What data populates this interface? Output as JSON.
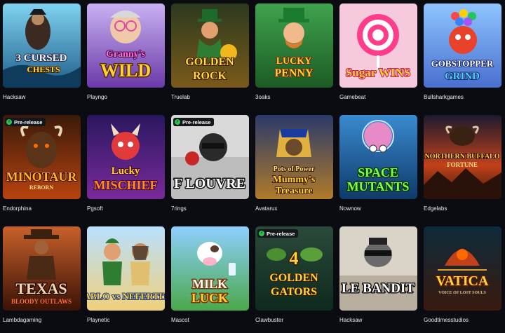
{
  "badge_label": "Pre-release",
  "games": [
    {
      "provider": "Hacksaw",
      "title": "3 Cursed Chests",
      "badge": false
    },
    {
      "provider": "Playngo",
      "title": "Granny's Wild",
      "badge": false
    },
    {
      "provider": "Truelab",
      "title": "Golden Rock",
      "badge": false
    },
    {
      "provider": "3oaks",
      "title": "Lucky Penny",
      "badge": false
    },
    {
      "provider": "Gamebeat",
      "title": "Sugar Wins",
      "badge": false
    },
    {
      "provider": "Bullsharkgames",
      "title": "Gobstopper Grind",
      "badge": false
    },
    {
      "provider": "Endorphina",
      "title": "Minotaur Reborn",
      "badge": true
    },
    {
      "provider": "Pgsoft",
      "title": "Lucky Mischief",
      "badge": false
    },
    {
      "provider": "7rings",
      "title": "F Louvre",
      "badge": true
    },
    {
      "provider": "Avatarux",
      "title": "Mummy's Treasure",
      "badge": false
    },
    {
      "provider": "Nownow",
      "title": "Space Mutants",
      "badge": false
    },
    {
      "provider": "Edgelabs",
      "title": "Northern Buffalo Fortune",
      "badge": false
    },
    {
      "provider": "Lambdagaming",
      "title": "Texas Bloody Outlaws",
      "badge": false
    },
    {
      "provider": "Playnetic",
      "title": "Pablo vs Nefertiti",
      "badge": false
    },
    {
      "provider": "Mascot",
      "title": "Milk and Luck",
      "badge": false
    },
    {
      "provider": "Clawbuster",
      "title": "4 Golden Gators",
      "badge": true
    },
    {
      "provider": "Hacksaw",
      "title": "Le Bandit",
      "badge": false
    },
    {
      "provider": "Goodtimesstudios",
      "title": "Vatica",
      "badge": false
    }
  ]
}
